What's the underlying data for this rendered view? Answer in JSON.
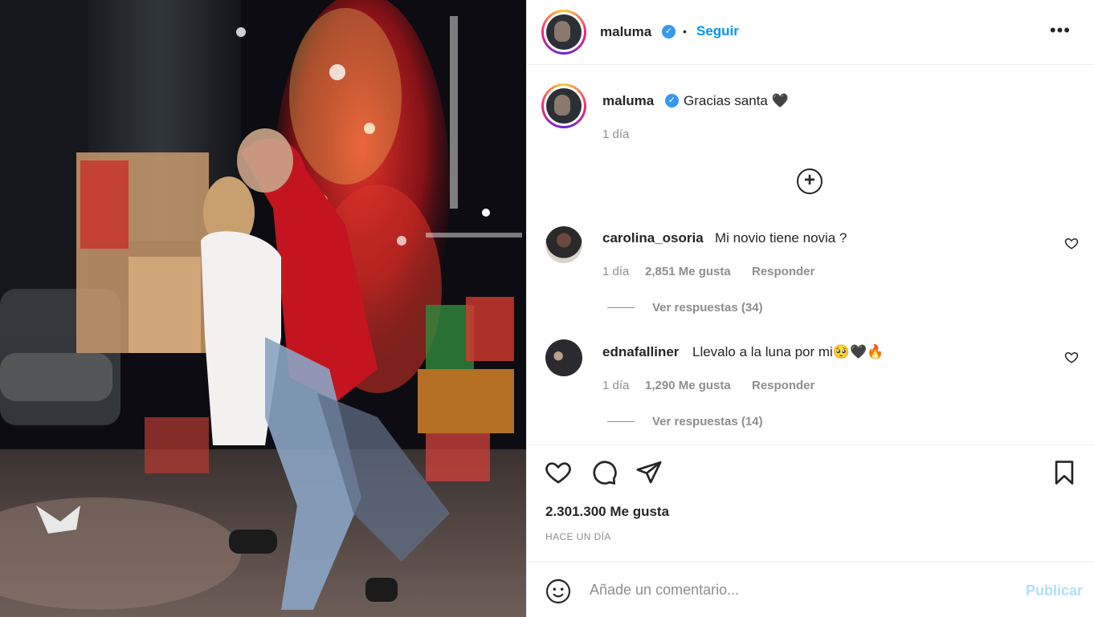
{
  "post": {
    "author": "maluma",
    "follow_label": "Seguir",
    "dot": "•",
    "more_icon": "more-options-icon",
    "more_glyph": "•••",
    "caption": "Gracias santa 🖤",
    "caption_time": "1 día",
    "likes": "2.301.300 Me gusta",
    "posted": "HACE UN DÍA"
  },
  "comments": [
    {
      "user": "carolina_osoria",
      "text": "Mi novio tiene novia ?",
      "time": "1 día",
      "likes": "2,851 Me gusta",
      "reply": "Responder",
      "view_replies": "Ver respuestas (34)"
    },
    {
      "user": "ednafalliner",
      "text": "Llevalo a la luna por mi🥺🖤🔥",
      "time": "1 día",
      "likes": "1,290 Me gusta",
      "reply": "Responder",
      "view_replies": "Ver respuestas (14)"
    }
  ],
  "composer": {
    "placeholder": "Añade un comentario...",
    "publish_label": "Publicar"
  },
  "colors": {
    "accent": "#0095f6",
    "verified": "#3897f0",
    "publish_disabled": "#b2dffc",
    "muted_text": "#8e8e8e"
  }
}
